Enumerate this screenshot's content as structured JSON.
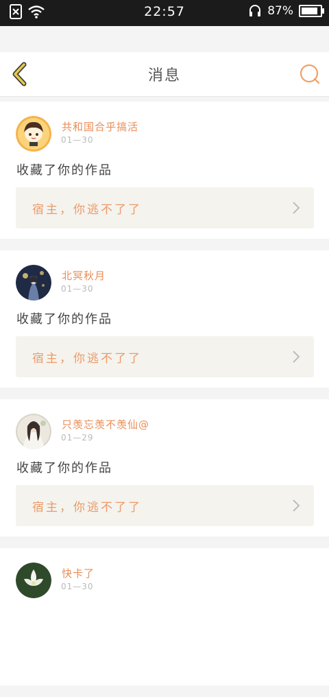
{
  "statusbar": {
    "time": "22:57",
    "battery_text": "87%",
    "battery_level": 0.87,
    "icons": [
      "sim-off-icon",
      "wifi-icon",
      "headset-icon",
      "battery-icon"
    ]
  },
  "header": {
    "title": "消息",
    "back_icon": "chevron-left-icon",
    "search_icon": "search-icon",
    "accent": "#e9b04a"
  },
  "messages": [
    {
      "username": "共和国合乎搞活",
      "date": "01—30",
      "action": "收藏了你的作品",
      "work_title": "宿主，你逃不了了"
    },
    {
      "username": "北冥秋月",
      "date": "01—30",
      "action": "收藏了你的作品",
      "work_title": "宿主，你逃不了了"
    },
    {
      "username": "只羡忘羡不羡仙@",
      "date": "01—29",
      "action": "收藏了你的作品",
      "work_title": "宿主，你逃不了了"
    },
    {
      "username": "快卡了",
      "date": "01—30",
      "action": "",
      "work_title": ""
    }
  ],
  "colors": {
    "username": "#e98d57",
    "work_title": "#ec9a68",
    "work_box": "#f4f3ee"
  }
}
